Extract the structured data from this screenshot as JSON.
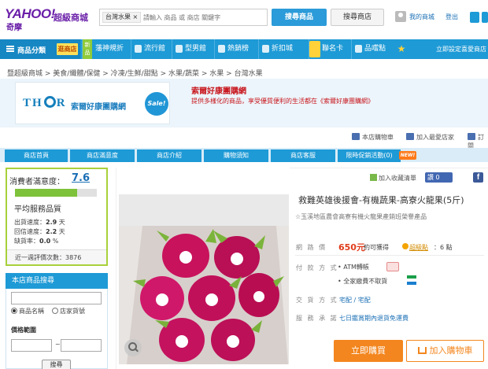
{
  "header": {
    "logo_main": "YAHOO!",
    "logo_sub": "奇摩",
    "mall_name": "超級商城",
    "search_tag": "台灣水果 ×",
    "search_placeholder": "請輸入 商品 或 商店 關鍵字",
    "search_product_btn": "搜尋商品",
    "search_store_btn": "搜尋商店",
    "my_shop": "我的商城",
    "logout": "登出"
  },
  "nav": {
    "category_label": "商品分類",
    "store_tag": "逛商店",
    "new_badge": "新品",
    "items": [
      "藩神規折",
      "流行館",
      "型男館",
      "熱銷榜",
      "折扣城",
      "聯名卡",
      "品嚐點"
    ],
    "preference": "立即設定喜愛商店"
  },
  "breadcrumb": [
    "暨超級商城",
    "美食/纖體/保健",
    "冷凍/生鮮/甜點",
    "水果/蔬菜",
    "水果",
    "台灣水果"
  ],
  "promo": {
    "brand": "THOR",
    "name": "索爾好康團購網",
    "sale": "Sale!",
    "title": "索爾好康團購網",
    "desc": "提供多樣化的商品，享受優質便利的生活都在《索爾好康團購網》"
  },
  "util": {
    "cart": "本店購物車",
    "favorite_store": "加入最愛店家",
    "subscribe": "訂閱"
  },
  "tabs": [
    "商店首頁",
    "商店滿意度",
    "商店介紹",
    "購物須知",
    "商店客服",
    "限時促銷活動(0)"
  ],
  "tabs_new_tag": "NEW!",
  "rating": {
    "label": "消費者滿意度：",
    "value": "7.6",
    "fill": 0.76,
    "service_title": "平均服務品質",
    "ship_label": "出貨速度：",
    "ship_value": "2.9",
    "ship_unit": "天",
    "reply_label": "回信速度：",
    "reply_value": "2.2",
    "reply_unit": "天",
    "short_label": "缺貨率：",
    "short_value": "0.0",
    "short_unit": "%",
    "total_label": "近一週評價次數：",
    "total_value": "3876"
  },
  "store_search": {
    "header": "本店商品搜尋",
    "radio_name": "商品名稱",
    "radio_code": "店家貨號",
    "price_title": "價格範圍",
    "dash": "~",
    "button": "搜尋"
  },
  "share": {
    "fav": "加入收藏清單",
    "like": "讚 0",
    "fb": "f"
  },
  "product": {
    "title": "救難英雄後援會-有機蔬果-高寮火龍果(5斤)",
    "subtitle": "☆玉溪地區農會高寮有機火龍果產銷班榮譽產品",
    "price_label": "網 路 價",
    "price": "650元",
    "points_text": "約可獲得",
    "super_points": "超級點",
    "points_val": "：6 點",
    "pay_label": "付 款 方 式",
    "pay_atm": "• ATM轉帳",
    "pay_family": "• 全家繳費不取貨",
    "delivery_label": "交 貨 方 式",
    "delivery": "宅配 / 宅配",
    "service_label": "服 務 承 諾",
    "service": "七日鑑賞期內退貨免運費",
    "buy_btn": "立即購買",
    "cart_btn": "加入購物車"
  },
  "colors": {
    "primary_blue": "#1e9ad6",
    "price_red": "#e03c1b",
    "orange": "#f3861e",
    "rating_green": "#7ec13a"
  }
}
